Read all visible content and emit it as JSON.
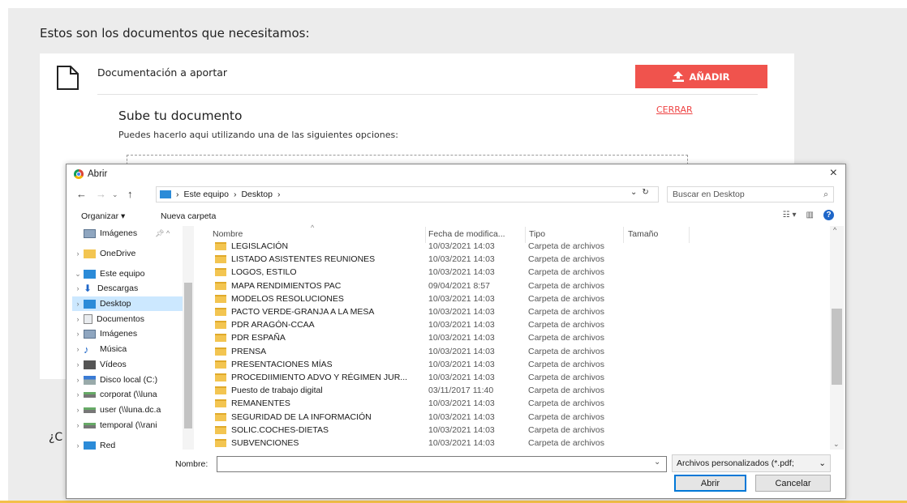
{
  "page": {
    "heading": "Estos son los documentos que necesitamos:",
    "doc_label": "Documentación a aportar",
    "add_button": "AÑADIR",
    "upload_title": "Sube tu documento",
    "close_link": "CERRAR",
    "upload_sub": "Puedes hacerlo aqui utilizando una de las siguientes opciones:",
    "bottom_text": "¿C",
    "accent_color": "#f0534d"
  },
  "dialog": {
    "title": "Abrir",
    "close_glyph": "×",
    "breadcrumb": [
      "Este equipo",
      "Desktop"
    ],
    "search_placeholder": "Buscar en Desktop",
    "toolbar": {
      "organize": "Organizar ▾",
      "new_folder": "Nueva carpeta"
    },
    "nav_items": [
      {
        "label": "Imágenes",
        "icon": "pictures-icon",
        "pinned": true
      },
      {
        "label": "OneDrive",
        "icon": "folder-icon"
      },
      {
        "label": "Este equipo",
        "icon": "computer-icon"
      },
      {
        "label": "Descargas",
        "icon": "download-icon"
      },
      {
        "label": "Desktop",
        "icon": "desktop-icon",
        "selected": true
      },
      {
        "label": "Documentos",
        "icon": "documents-icon"
      },
      {
        "label": "Imágenes",
        "icon": "pictures-icon"
      },
      {
        "label": "Música",
        "icon": "music-icon"
      },
      {
        "label": "Vídeos",
        "icon": "videos-icon"
      },
      {
        "label": "Disco local (C:)",
        "icon": "drive-icon"
      },
      {
        "label": "corporat (\\\\luna",
        "icon": "network-drive-icon"
      },
      {
        "label": "user (\\\\luna.dc.a",
        "icon": "network-drive-icon"
      },
      {
        "label": "temporal (\\\\rani",
        "icon": "network-drive-icon"
      },
      {
        "label": "Red",
        "icon": "network-icon"
      }
    ],
    "columns": {
      "name": "Nombre",
      "date": "Fecha de modifica...",
      "type": "Tipo",
      "size": "Tamaño"
    },
    "files": [
      {
        "name": "LEGISLACIÓN",
        "date": "10/03/2021 14:03",
        "type": "Carpeta de archivos"
      },
      {
        "name": "LISTADO ASISTENTES REUNIONES",
        "date": "10/03/2021 14:03",
        "type": "Carpeta de archivos"
      },
      {
        "name": "LOGOS, ESTILO",
        "date": "10/03/2021 14:03",
        "type": "Carpeta de archivos"
      },
      {
        "name": "MAPA RENDIMIENTOS PAC",
        "date": "09/04/2021 8:57",
        "type": "Carpeta de archivos"
      },
      {
        "name": "MODELOS RESOLUCIONES",
        "date": "10/03/2021 14:03",
        "type": "Carpeta de archivos"
      },
      {
        "name": "PACTO VERDE-GRANJA A LA MESA",
        "date": "10/03/2021 14:03",
        "type": "Carpeta de archivos"
      },
      {
        "name": "PDR ARAGÓN-CCAA",
        "date": "10/03/2021 14:03",
        "type": "Carpeta de archivos"
      },
      {
        "name": "PDR ESPAÑA",
        "date": "10/03/2021 14:03",
        "type": "Carpeta de archivos"
      },
      {
        "name": "PRENSA",
        "date": "10/03/2021 14:03",
        "type": "Carpeta de archivos"
      },
      {
        "name": "PRESENTACIONES MÍAS",
        "date": "10/03/2021 14:03",
        "type": "Carpeta de archivos"
      },
      {
        "name": "PROCEDIIMIENTO ADVO Y RÉGIMEN JUR...",
        "date": "10/03/2021 14:03",
        "type": "Carpeta de archivos"
      },
      {
        "name": "Puesto de trabajo digital",
        "date": "03/11/2017 11:40",
        "type": "Carpeta de archivos"
      },
      {
        "name": "REMANENTES",
        "date": "10/03/2021 14:03",
        "type": "Carpeta de archivos"
      },
      {
        "name": "SEGURIDAD DE LA INFORMACIÓN",
        "date": "10/03/2021 14:03",
        "type": "Carpeta de archivos"
      },
      {
        "name": "SOLIC.COCHES-DIETAS",
        "date": "10/03/2021 14:03",
        "type": "Carpeta de archivos"
      },
      {
        "name": "SUBVENCIONES",
        "date": "10/03/2021 14:03",
        "type": "Carpeta de archivos"
      }
    ],
    "footer": {
      "name_label": "Nombre:",
      "name_value": "",
      "filter": "Archivos personalizados (*.pdf;",
      "open": "Abrir",
      "cancel": "Cancelar"
    }
  }
}
